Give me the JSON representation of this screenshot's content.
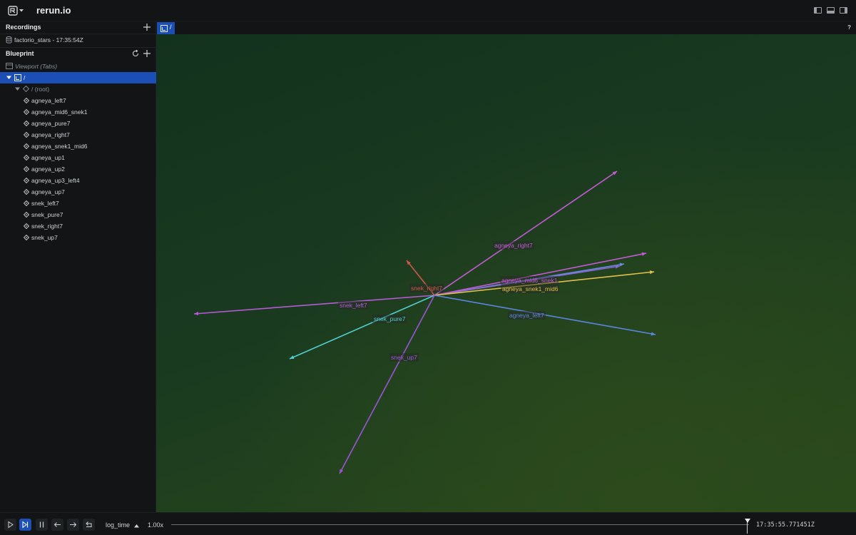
{
  "app": {
    "title": "rerun.io"
  },
  "recordings": {
    "title": "Recordings",
    "items": [
      {
        "label": "factorio_stars - 17:35:54Z"
      }
    ]
  },
  "blueprint": {
    "title": "Blueprint",
    "viewport_label": "Viewport (Tabs)",
    "view_label": "/",
    "root_label": "/ (root)",
    "entities": [
      "agneya_left7",
      "agneya_mid6_snek1",
      "agneya_pure7",
      "agneya_right7",
      "agneya_snek1_mid6",
      "agneya_up1",
      "agneya_up2",
      "agneya_up3_left4",
      "agneya_up7",
      "snek_left7",
      "snek_pure7",
      "snek_right7",
      "snek_up7"
    ]
  },
  "view_tab": {
    "label": "/",
    "help": "?"
  },
  "arrows": [
    {
      "label": "agneya_right7",
      "color": "#c45ad6"
    },
    {
      "label": "agneya_mid6_snek1",
      "color": "#c45ad6"
    },
    {
      "label": "agneya_snek1_mid6",
      "color": "#e0c04a"
    },
    {
      "label": "agneya_left7",
      "color": "#5b86e0"
    },
    {
      "label": "snek_right7",
      "color": "#d0574a"
    },
    {
      "label": "snek_left7",
      "color": "#b65ad6"
    },
    {
      "label": "snek_pure7",
      "color": "#4fcfcf"
    },
    {
      "label": "snek_up7",
      "color": "#9a55d6"
    }
  ],
  "timeline": {
    "name": "log_time",
    "speed": "1.00x",
    "current_time": "17:35:55.771451Z"
  }
}
